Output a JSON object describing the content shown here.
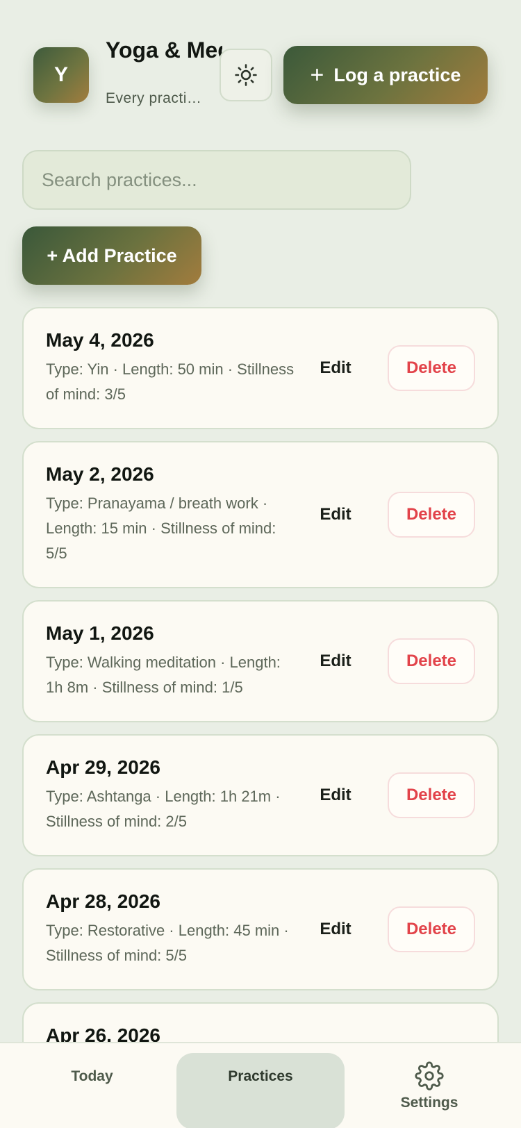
{
  "header": {
    "logo_letter": "Y",
    "title": "Yoga & Meditation",
    "subtitle": "Every practice counts",
    "theme_icon": "sun-icon",
    "log_button_label": "Log a practice"
  },
  "search": {
    "placeholder": "Search practices..."
  },
  "add_button_label": "+ Add Practice",
  "practices": [
    {
      "date": "May 4, 2026",
      "details": "Type: Yin · Length: 50 min · Stillness of mind: 3/5",
      "edit_label": "Edit",
      "delete_label": "Delete"
    },
    {
      "date": "May 2, 2026",
      "details": "Type: Pranayama / breath work · Length: 15 min · Stillness of mind: 5/5",
      "edit_label": "Edit",
      "delete_label": "Delete"
    },
    {
      "date": "May 1, 2026",
      "details": "Type: Walking meditation · Length: 1h 8m · Stillness of mind: 1/5",
      "edit_label": "Edit",
      "delete_label": "Delete"
    },
    {
      "date": "Apr 29, 2026",
      "details": "Type: Ashtanga · Length: 1h 21m · Stillness of mind: 2/5",
      "edit_label": "Edit",
      "delete_label": "Delete"
    },
    {
      "date": "Apr 28, 2026",
      "details": "Type: Restorative · Length: 45 min · Stillness of mind: 5/5",
      "edit_label": "Edit",
      "delete_label": "Delete"
    },
    {
      "date": "Apr 26, 2026"
    }
  ],
  "tabs": [
    {
      "label": "Today",
      "active": false
    },
    {
      "label": "Practices",
      "active": true
    },
    {
      "label": "Settings",
      "icon": "gear-icon",
      "active": false
    }
  ],
  "colors": {
    "background": "#e9eee5",
    "card": "#fcfaf3",
    "accent_dark": "#3b593a",
    "accent_light": "#a27d3e",
    "danger": "#e2434a"
  }
}
